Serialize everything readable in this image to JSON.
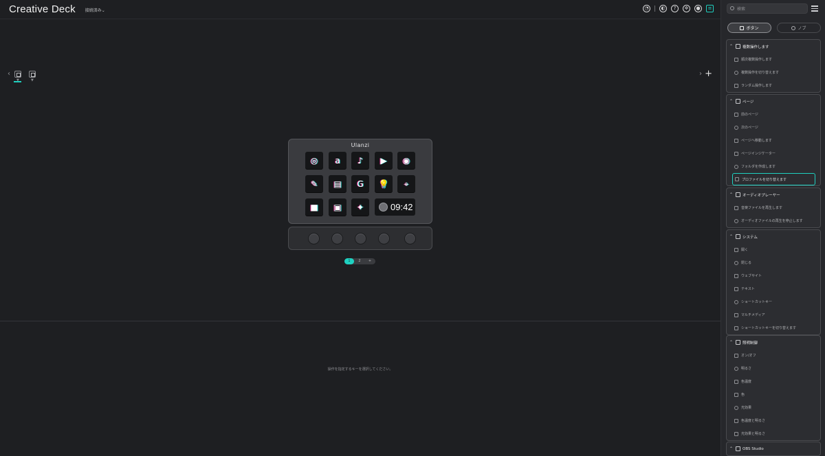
{
  "app": {
    "title": "Creative Deck",
    "connection": "接続済み⌄"
  },
  "top_icons": [
    "chart-icon",
    "browser-icon",
    "help-icon",
    "settings-icon",
    "account-icon",
    "panel-icon"
  ],
  "pages": {
    "add_label": "+"
  },
  "device": {
    "brand": "Ulanzi",
    "keys": [
      {
        "glyph": "◎",
        "name": "key-app-1"
      },
      {
        "glyph": "a",
        "name": "key-amazon"
      },
      {
        "glyph": "♪",
        "name": "key-tiktok"
      },
      {
        "glyph": "▶",
        "name": "key-youtube"
      },
      {
        "glyph": "◉",
        "name": "key-record"
      },
      {
        "glyph": "✎",
        "name": "key-pen"
      },
      {
        "glyph": "▤",
        "name": "key-clapper"
      },
      {
        "glyph": "G",
        "name": "key-google"
      },
      {
        "glyph": "💡",
        "name": "key-bulb"
      },
      {
        "glyph": "⌖",
        "name": "key-location"
      },
      {
        "glyph": "■",
        "name": "key-video"
      },
      {
        "glyph": "▣",
        "name": "key-image"
      },
      {
        "glyph": "✦",
        "name": "key-twitter"
      }
    ],
    "clock_time": "09:42",
    "knobs": 5
  },
  "pager": {
    "pages": [
      "1",
      "2",
      "+"
    ],
    "active": 0
  },
  "hint": "操作を指定するキーを選択してください。",
  "panel": {
    "search_placeholder": "検索",
    "tabs": [
      {
        "label": "ボタン",
        "active": true
      },
      {
        "label": "ノブ",
        "active": false
      }
    ],
    "groups": [
      {
        "title": "複数操作します",
        "items": [
          "順次複数操作します",
          "複数操作を切り替えます",
          "ランダム操作します"
        ],
        "selected": -1
      },
      {
        "title": "ページ",
        "items": [
          "前のページ",
          "次のページ",
          "ページへ移動します",
          "ページインジケーター",
          "フォルダを作成します",
          "プロファイルを切り替えます"
        ],
        "selected": 5
      },
      {
        "title": "オーディオプレーヤー",
        "items": [
          "音楽ファイルを再生します",
          "オーディオファイルの再生を停止します"
        ],
        "selected": -1
      },
      {
        "title": "システム",
        "items": [
          "開く",
          "閉じる",
          "ウェブサイト",
          "テキスト",
          "ショートカットキー",
          "マルチメディア",
          "ショートカットキーを切り替えます"
        ],
        "selected": -1
      },
      {
        "title": "照明制御",
        "items": [
          "オン/オフ",
          "明るさ",
          "色温度",
          "色",
          "光効果",
          "色温度と明るさ",
          "光効果と明るさ"
        ],
        "selected": -1
      },
      {
        "title": "OBS Studio",
        "items": [],
        "selected": -1
      }
    ]
  }
}
